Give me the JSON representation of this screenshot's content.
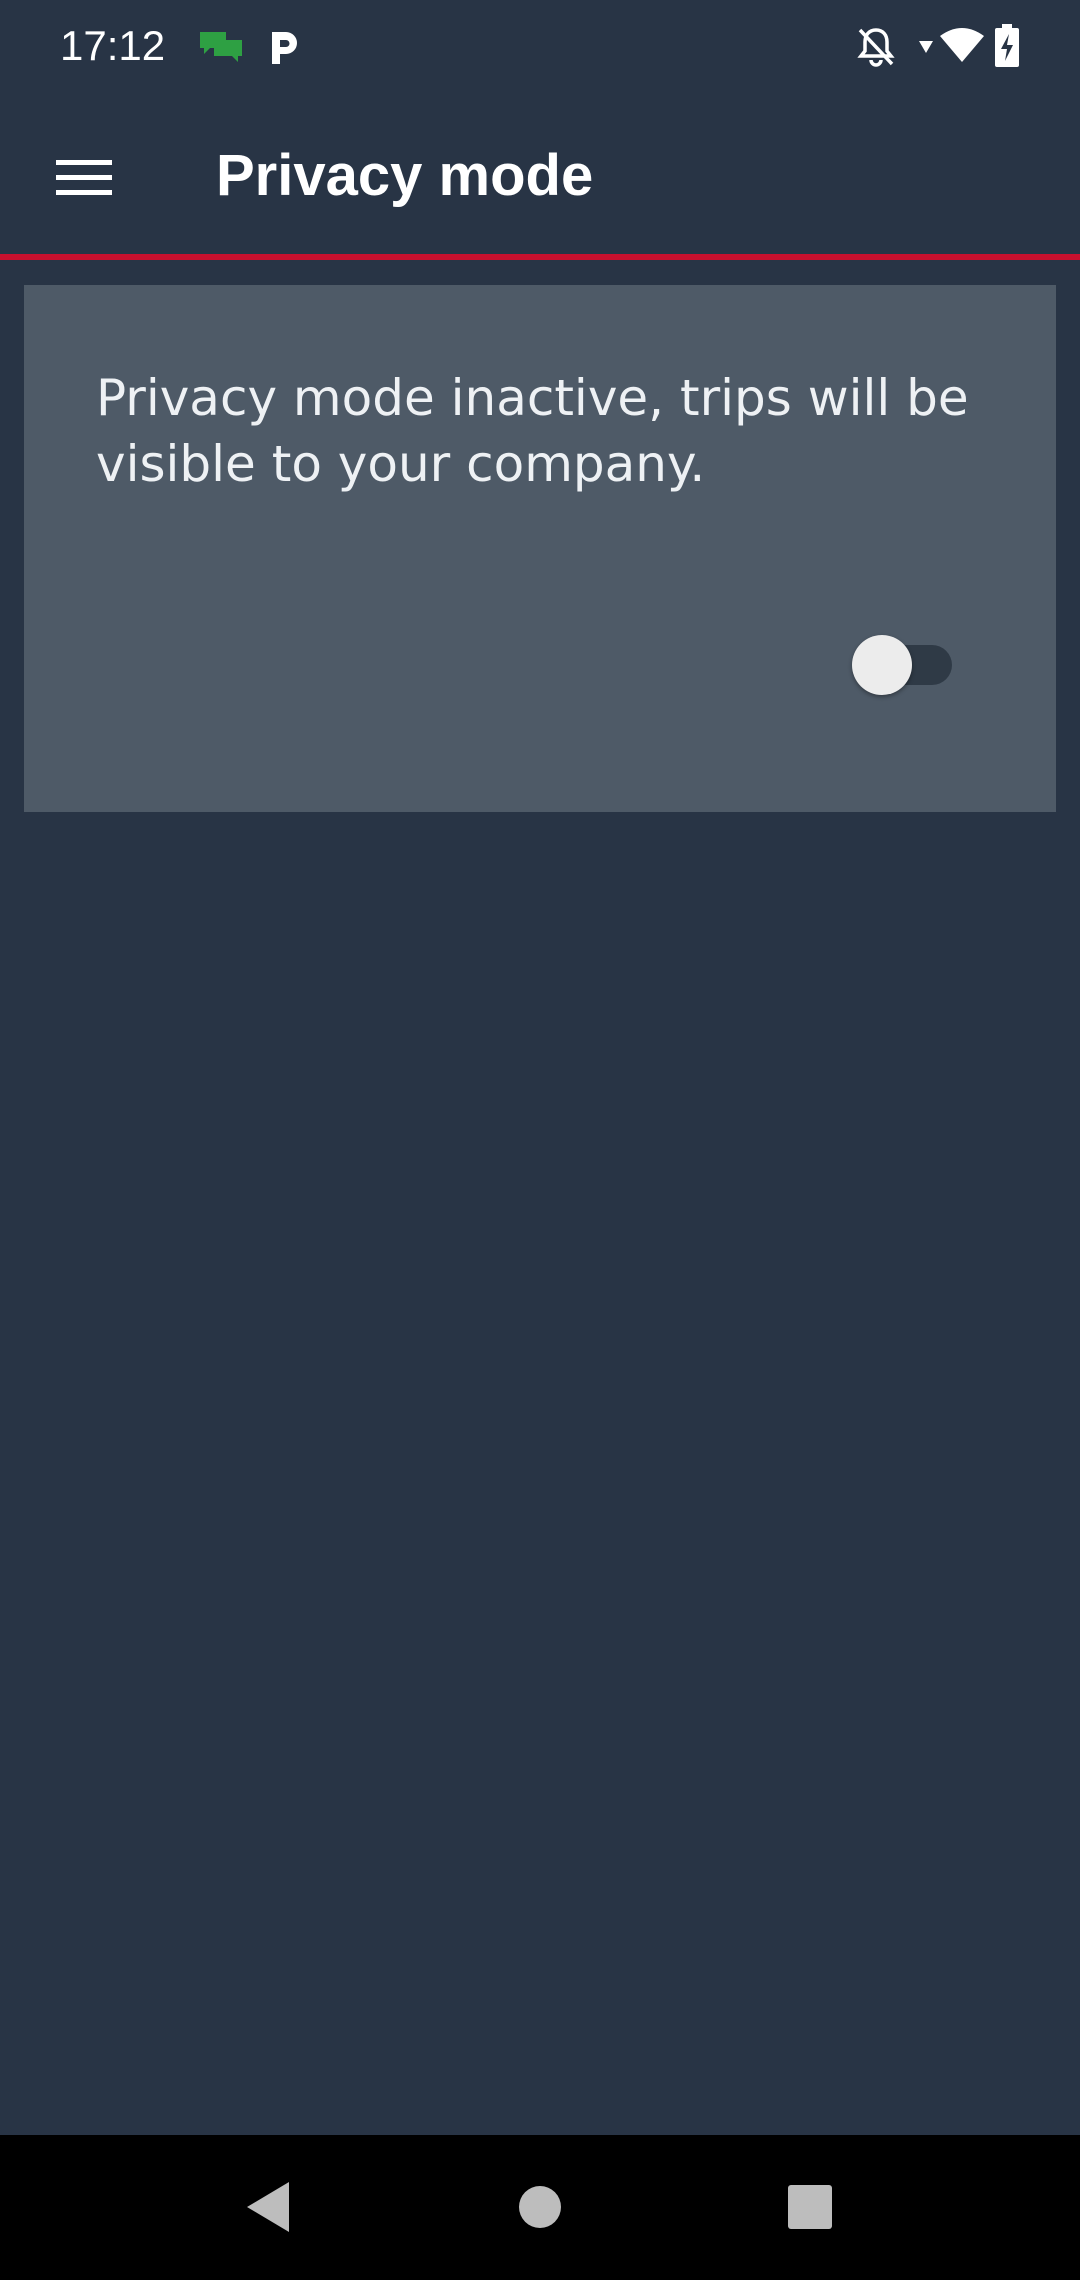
{
  "status_bar": {
    "time": "17:12",
    "icons": [
      "messages-icon",
      "parking-app-icon",
      "notifications-off-icon",
      "wifi-icon",
      "battery-charging-icon"
    ]
  },
  "app_bar": {
    "title": "Privacy mode",
    "menu_icon": "hamburger-menu-icon"
  },
  "colors": {
    "background": "#283445",
    "card": "#4e5a67",
    "accent": "#c8102e",
    "nav_bar": "#000000"
  },
  "privacy_card": {
    "message": "Privacy mode inactive, trips will be visible to your company.",
    "toggle_on": false
  },
  "nav_bar": {
    "buttons": [
      "back-icon",
      "home-icon",
      "recents-icon"
    ]
  }
}
